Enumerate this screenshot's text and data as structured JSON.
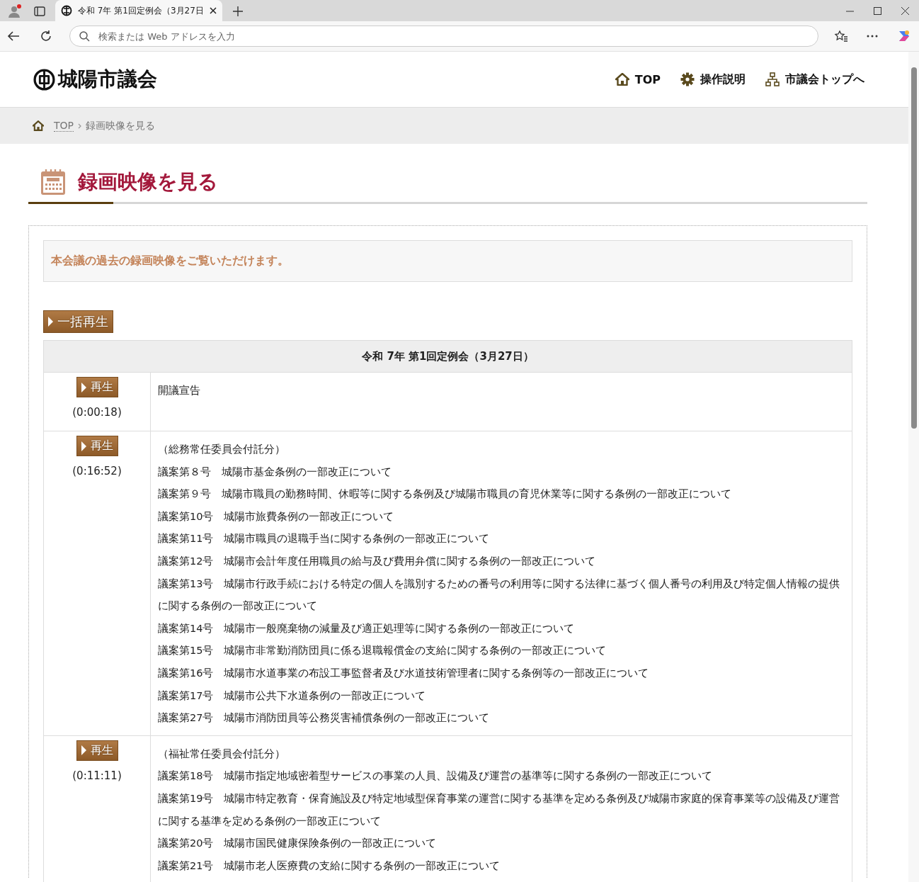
{
  "browser": {
    "tab_title": "令和 7年 第1回定例会（3月27日",
    "address_placeholder": "検索または Web アドレスを入力"
  },
  "header": {
    "logo": "城陽市議会",
    "nav": [
      {
        "kind": "home",
        "label": "TOP"
      },
      {
        "kind": "gear",
        "label": "操作説明"
      },
      {
        "kind": "sitemap",
        "label": "市議会トップへ"
      }
    ]
  },
  "breadcrumb": {
    "items": [
      "TOP",
      "録画映像を見る"
    ]
  },
  "page_title": "録画映像を見る",
  "intro": "本会議の過去の録画映像をご覧いただけます。",
  "play_all_button": "一括再生",
  "table": {
    "title": "令和 7年 第1回定例会（3月27日）",
    "rows": [
      {
        "button": "再生",
        "time": "(0:00:18)",
        "lines": [
          "開議宣告"
        ]
      },
      {
        "button": "再生",
        "time": "(0:16:52)",
        "lines": [
          "（総務常任委員会付託分）",
          "議案第８号　城陽市基金条例の一部改正について",
          "議案第９号　城陽市職員の勤務時間、休暇等に関する条例及び城陽市職員の育児休業等に関する条例の一部改正について",
          "議案第10号　城陽市旅費条例の一部改正について",
          "議案第11号　城陽市職員の退職手当に関する条例の一部改正について",
          "議案第12号　城陽市会計年度任用職員の給与及び費用弁償に関する条例の一部改正について",
          "議案第13号　城陽市行政手続における特定の個人を識別するための番号の利用等に関する法律に基づく個人番号の利用及び特定個人情報の提供に関する条例の一部改正について",
          "議案第14号　城陽市一般廃棄物の減量及び適正処理等に関する条例の一部改正について",
          "議案第15号　城陽市非常勤消防団員に係る退職報償金の支給に関する条例の一部改正について",
          "議案第16号　城陽市水道事業の布設工事監督者及び水道技術管理者に関する条例等の一部改正について",
          "議案第17号　城陽市公共下水道条例の一部改正について",
          "議案第27号　城陽市消防団員等公務災害補償条例の一部改正について"
        ]
      },
      {
        "button": "再生",
        "time": "(0:11:11)",
        "lines": [
          "（福祉常任委員会付託分）",
          "議案第18号　城陽市指定地域密着型サービスの事業の人員、設備及び運営の基準等に関する条例の一部改正について",
          "議案第19号　城陽市特定教育・保育施設及び特定地域型保育事業の運営に関する基準を定める条例及び城陽市家庭的保育事業等の設備及び運営に関する基準を定める条例の一部改正について",
          "議案第20号　城陽市国民健康保険条例の一部改正について",
          "議案第21号　城陽市老人医療費の支給に関する条例の一部改正について"
        ]
      }
    ]
  }
}
